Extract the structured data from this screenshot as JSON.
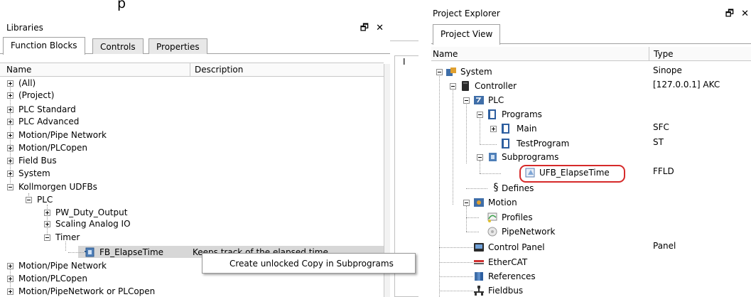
{
  "cut_text": "p",
  "libraries": {
    "title": "Libraries",
    "window_controls": "🗗 ✕",
    "tabs": [
      "Function Blocks",
      "Controls",
      "Properties"
    ],
    "columns": [
      "Name",
      "Description"
    ],
    "tree": [
      "(All)",
      "(Project)",
      "PLC Standard",
      "PLC Advanced",
      "Motion/Pipe Network",
      "Motion/PLCopen",
      "Field Bus",
      "System",
      "Kollmorgen UDFBs",
      "PLC",
      "PW_Duty_Output",
      "Scaling Analog IO",
      "Timer",
      "FB_ElapseTime",
      "Motion/Pipe Network",
      "Motion/PLCopen",
      "Motion/PipeNetwork or PLCopen"
    ],
    "selected_description": "Keeps track of the elapsed time",
    "context_menu_item": "Create unlocked Copy in Subprograms"
  },
  "middle": {
    "mark": "I"
  },
  "explorer": {
    "title": "Project Explorer",
    "window_controls": "🗗 ✕",
    "tab": "Project View",
    "columns": [
      "Name",
      "Type"
    ],
    "tree": [
      {
        "name": "System",
        "type": "Sinope"
      },
      {
        "name": "Controller",
        "type": "[127.0.0.1] AKC"
      },
      {
        "name": "PLC",
        "type": ""
      },
      {
        "name": "Programs",
        "type": ""
      },
      {
        "name": "Main",
        "type": "SFC"
      },
      {
        "name": "TestProgram",
        "type": "ST"
      },
      {
        "name": "Subprograms",
        "type": ""
      },
      {
        "name": "UFB_ElapseTime",
        "type": "FFLD"
      },
      {
        "name": "Defines",
        "type": ""
      },
      {
        "name": "Motion",
        "type": ""
      },
      {
        "name": "Profiles",
        "type": ""
      },
      {
        "name": "PipeNetwork",
        "type": ""
      },
      {
        "name": "Control Panel",
        "type": "Panel"
      },
      {
        "name": "EtherCAT",
        "type": ""
      },
      {
        "name": "References",
        "type": ""
      },
      {
        "name": "Fieldbus",
        "type": ""
      }
    ]
  },
  "colors": {
    "highlight": "#d62a2a",
    "selection": "#d7d7d7",
    "tree_lines": "#9a9a9a"
  }
}
